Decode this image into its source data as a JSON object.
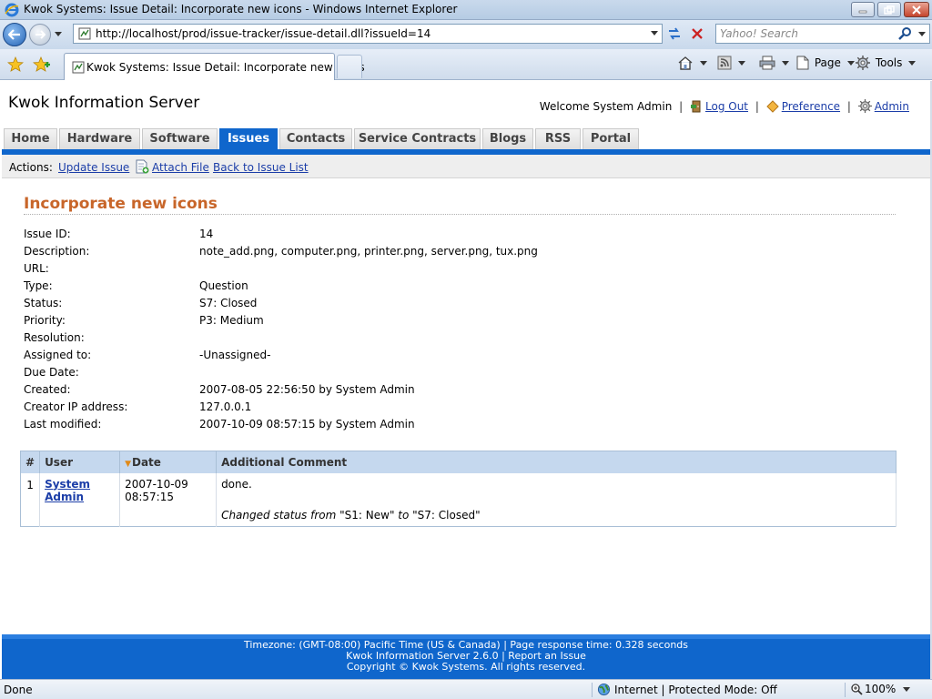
{
  "browser": {
    "window_title": "Kwok Systems: Issue Detail: Incorporate new icons - Windows Internet Explorer",
    "address_url": "http://localhost/prod/issue-tracker/issue-detail.dll?issueId=14",
    "search_placeholder": "Yahoo! Search",
    "tab_label": "Kwok Systems: Issue Detail: Incorporate new icons",
    "toolbar": {
      "page_label": "Page",
      "tools_label": "Tools"
    },
    "status": {
      "text": "Done",
      "zone": "Internet | Protected Mode: Off",
      "zoom": "100%"
    }
  },
  "site": {
    "title": "Kwok Information Server",
    "welcome": "Welcome System Admin",
    "logout": "Log Out",
    "preference": "Preference",
    "admin": "Admin"
  },
  "nav_tabs": [
    {
      "label": "Home"
    },
    {
      "label": "Hardware"
    },
    {
      "label": "Software"
    },
    {
      "label": "Issues",
      "active": true
    },
    {
      "label": "Contacts"
    },
    {
      "label": "Service Contracts"
    },
    {
      "label": "Blogs"
    },
    {
      "label": "RSS"
    },
    {
      "label": "Portal"
    }
  ],
  "actions": {
    "label": "Actions:",
    "update_issue": "Update Issue",
    "attach_file": "Attach File",
    "back_to_list": "Back to Issue List"
  },
  "issue": {
    "title": "Incorporate new icons",
    "fields": [
      {
        "label": "Issue ID:",
        "value": "14"
      },
      {
        "label": "Description:",
        "value": "note_add.png, computer.png, printer.png, server.png, tux.png"
      },
      {
        "label": "URL:",
        "value": ""
      },
      {
        "label": "Type:",
        "value": "Question"
      },
      {
        "label": "Status:",
        "value": "S7: Closed"
      },
      {
        "label": "Priority:",
        "value": "P3: Medium"
      },
      {
        "label": "Resolution:",
        "value": ""
      },
      {
        "label": "Assigned to:",
        "value": "-Unassigned-"
      },
      {
        "label": "Due Date:",
        "value": ""
      },
      {
        "label": "Created:",
        "value": "2007-08-05 22:56:50 by System Admin"
      },
      {
        "label": "Creator IP address:",
        "value": "127.0.0.1"
      },
      {
        "label": "Last modified:",
        "value": "2007-10-09 08:57:15 by System Admin"
      }
    ]
  },
  "comments": {
    "headers": {
      "num": "#",
      "user": "User",
      "date": "Date",
      "comment": "Additional Comment"
    },
    "rows": [
      {
        "num": "1",
        "user": "System Admin",
        "date": "2007-10-09 08:57:15",
        "comment": "done.",
        "change_prefix": "Changed status from ",
        "change_from": "\"S1: New\"",
        "change_mid": " to ",
        "change_to": "\"S7: Closed\""
      }
    ]
  },
  "footer": {
    "line1": "Timezone: (GMT-08:00) Pacific Time (US & Canada) | Page response time: 0.328 seconds",
    "line2": "Kwok Information Server 2.6.0 | Report an Issue",
    "line3": "Copyright © Kwok Systems. All rights reserved."
  }
}
